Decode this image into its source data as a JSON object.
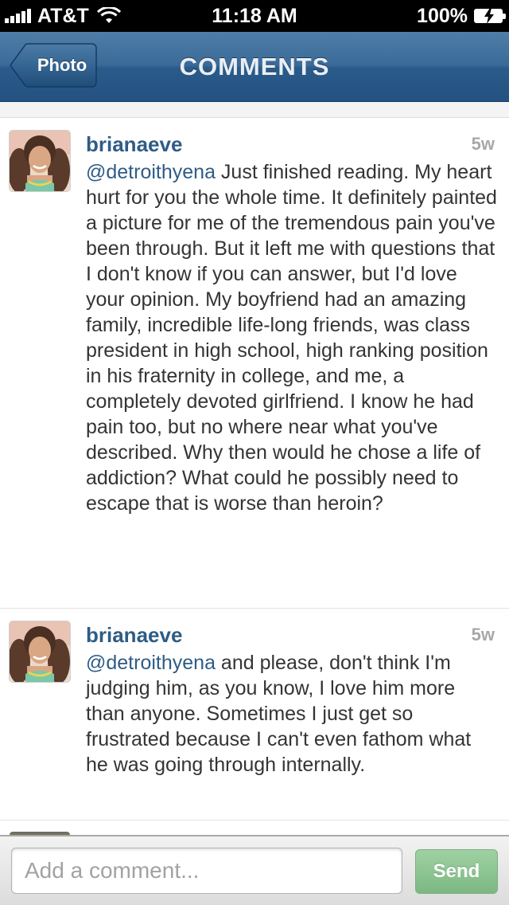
{
  "status_bar": {
    "carrier": "AT&T",
    "time": "11:18 AM",
    "battery": "100%"
  },
  "nav": {
    "back_label": "Photo",
    "title": "COMMENTS"
  },
  "comments": [
    {
      "username": "brianaeve",
      "time_ago": "5w",
      "mention": "@detroithyena",
      "text": " Just finished reading. My heart hurt for you the whole time. It definitely painted a picture for me of the tremendous pain you've been through. But it left me with questions that I don't know if you can answer, but I'd love your opinion. My boyfriend had an amazing family, incredible life-long friends, was class president in high school, high ranking position in his fraternity in college, and me, a completely devoted girlfriend. I know he had pain too, but no where near what you've described. Why then would he chose a life of addiction? What could he possibly need to escape that is worse than heroin?"
    },
    {
      "username": "brianaeve",
      "time_ago": "5w",
      "mention": "@detroithyena",
      "text": " and please, don't think I'm judging him, as you know, I love him more than anyone. Sometimes I just get so frustrated because I can't even fathom what he was going through internally."
    }
  ],
  "composer": {
    "placeholder": "Add a comment...",
    "value": "",
    "send_label": "Send"
  },
  "colors": {
    "nav_blue": "#2b5b8a",
    "username_blue": "#2f5c85",
    "send_green": "#8cc592"
  }
}
